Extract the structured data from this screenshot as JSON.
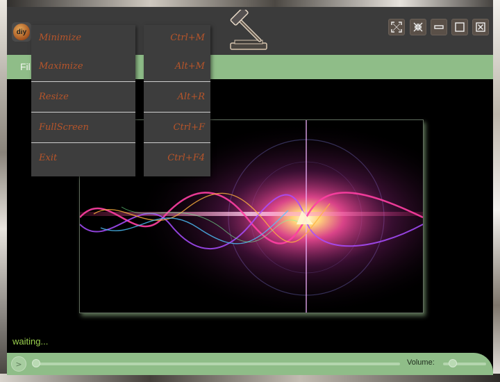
{
  "app": {
    "icon_label": "diy"
  },
  "window_controls": [
    {
      "name": "fit-screen-button",
      "icon": "expand-corners-icon"
    },
    {
      "name": "shrink-button",
      "icon": "shrink-arrows-icon"
    },
    {
      "name": "minimize-button",
      "icon": "minimize-icon"
    },
    {
      "name": "maximize-button",
      "icon": "maximize-icon"
    },
    {
      "name": "close-button",
      "icon": "close-box-icon"
    }
  ],
  "menubar": {
    "file_label": "Fil"
  },
  "menu": {
    "items": [
      {
        "label": "Minimize",
        "shortcut": "Ctrl+M"
      },
      {
        "label": "Maximize",
        "shortcut": "Alt+M"
      },
      {
        "label": "Resize",
        "shortcut": "Alt+R"
      },
      {
        "label": "FullScreen",
        "shortcut": "Ctrl+F"
      },
      {
        "label": "Exit",
        "shortcut": "Ctrl+F4"
      }
    ]
  },
  "status": {
    "text": "waiting..."
  },
  "controls": {
    "play_label": ">",
    "volume_label": "Volume:"
  },
  "colors": {
    "accent_green": "#8fbd88",
    "menu_text": "#b8552a",
    "status_text": "#9bd04e",
    "titlebar": "#3b3b3b"
  }
}
